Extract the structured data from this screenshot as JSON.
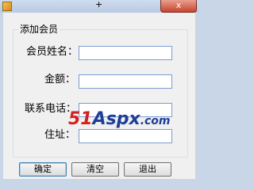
{
  "window": {
    "title": "",
    "close_glyph": "x",
    "cursor_glyph": "+"
  },
  "group": {
    "legend": "添加会员"
  },
  "form": {
    "name_label": "会员姓名：",
    "amount_label": "金额：",
    "phone_label": "联系电话：",
    "address_label": "住址：",
    "name_value": "",
    "amount_value": "",
    "phone_value": "",
    "address_value": ""
  },
  "buttons": {
    "ok": "确定",
    "clear": "清空",
    "exit": "退出"
  },
  "watermark": {
    "num": "51",
    "text": "Aspx",
    "domain": ".com"
  }
}
